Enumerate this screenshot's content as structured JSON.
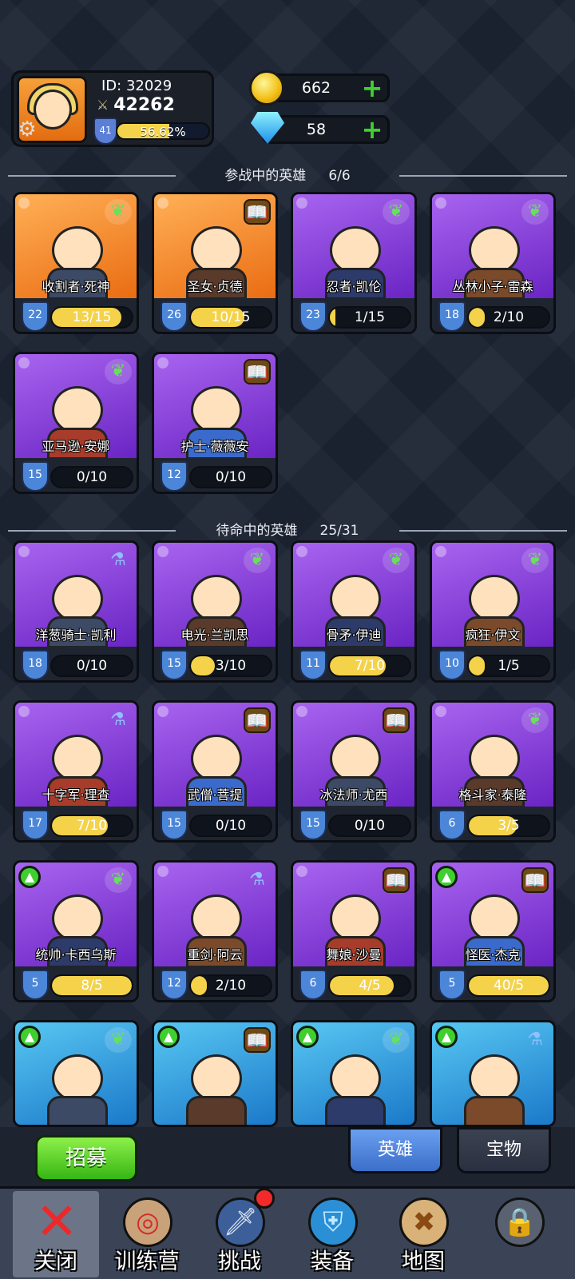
{
  "player": {
    "id_text": "ID: 32029",
    "power": "42262",
    "level": "41",
    "xp_percent_text": "56.62%",
    "xp_percent": 56.62
  },
  "currency": {
    "gold": "662",
    "gems": "58"
  },
  "sections": {
    "active": {
      "title": "参战中的英雄",
      "count": "6/6"
    },
    "standby": {
      "title": "待命中的英雄",
      "count": "25/31"
    }
  },
  "heroes": [
    {
      "name": "收割者·死神",
      "level": "22",
      "progress": "13/15",
      "fill": 0.87,
      "bg": "orange",
      "badge": "wing",
      "up": false
    },
    {
      "name": "圣女·贞德",
      "level": "26",
      "progress": "10/15",
      "fill": 0.67,
      "bg": "orange",
      "badge": "book",
      "up": false
    },
    {
      "name": "忍者·凯伦",
      "level": "23",
      "progress": "1/15",
      "fill": 0.07,
      "bg": "purple",
      "badge": "wing",
      "up": false
    },
    {
      "name": "丛林小子·雷森",
      "level": "18",
      "progress": "2/10",
      "fill": 0.2,
      "bg": "purple",
      "badge": "wing",
      "up": false
    },
    {
      "name": "亚马逊·安娜",
      "level": "15",
      "progress": "0/10",
      "fill": 0,
      "bg": "purple",
      "badge": "wing",
      "up": false
    },
    {
      "name": "护士·薇薇安",
      "level": "12",
      "progress": "0/10",
      "fill": 0,
      "bg": "purple",
      "badge": "book",
      "up": false
    },
    {
      "name": "洋葱骑士·凯利",
      "level": "18",
      "progress": "0/10",
      "fill": 0,
      "bg": "purple",
      "badge": "pot",
      "up": false
    },
    {
      "name": "电光·兰凯思",
      "level": "15",
      "progress": "3/10",
      "fill": 0.3,
      "bg": "purple",
      "badge": "wing",
      "up": false
    },
    {
      "name": "骨矛·伊迪",
      "level": "11",
      "progress": "7/10",
      "fill": 0.7,
      "bg": "purple",
      "badge": "wing",
      "up": false
    },
    {
      "name": "疯狂·伊文",
      "level": "10",
      "progress": "1/5",
      "fill": 0.2,
      "bg": "purple",
      "badge": "wing",
      "up": false
    },
    {
      "name": "十字军·理查",
      "level": "17",
      "progress": "7/10",
      "fill": 0.7,
      "bg": "purple",
      "badge": "pot",
      "up": false
    },
    {
      "name": "武僧·菩提",
      "level": "15",
      "progress": "0/10",
      "fill": 0,
      "bg": "purple",
      "badge": "book",
      "up": false
    },
    {
      "name": "冰法师·尤西",
      "level": "15",
      "progress": "0/10",
      "fill": 0,
      "bg": "purple",
      "badge": "book",
      "up": false
    },
    {
      "name": "格斗家·泰隆",
      "level": "6",
      "progress": "3/5",
      "fill": 0.6,
      "bg": "purple",
      "badge": "wing",
      "up": false
    },
    {
      "name": "统帅·卡西乌斯",
      "level": "5",
      "progress": "8/5",
      "fill": 1,
      "bg": "purple",
      "badge": "wing",
      "up": true
    },
    {
      "name": "重剑·阿云",
      "level": "12",
      "progress": "2/10",
      "fill": 0.2,
      "bg": "purple",
      "badge": "pot",
      "up": false
    },
    {
      "name": "舞娘·沙曼",
      "level": "6",
      "progress": "4/5",
      "fill": 0.8,
      "bg": "purple",
      "badge": "book",
      "up": false
    },
    {
      "name": "怪医·杰克",
      "level": "5",
      "progress": "40/5",
      "fill": 1,
      "bg": "purple",
      "badge": "book",
      "up": true
    },
    {
      "name": "",
      "level": "",
      "progress": "",
      "fill": 0,
      "bg": "blue",
      "badge": "wing",
      "up": true
    },
    {
      "name": "",
      "level": "",
      "progress": "",
      "fill": 0,
      "bg": "blue",
      "badge": "book",
      "up": true
    },
    {
      "name": "",
      "level": "",
      "progress": "",
      "fill": 0,
      "bg": "blue",
      "badge": "wing",
      "up": true
    },
    {
      "name": "",
      "level": "",
      "progress": "",
      "fill": 0,
      "bg": "blue",
      "badge": "pot",
      "up": true
    }
  ],
  "buttons": {
    "recruit": "招募"
  },
  "tabs": {
    "heroes": "英雄",
    "treasure": "宝物"
  },
  "nav": {
    "close": "关闭",
    "training": "训练营",
    "challenge": "挑战",
    "equipment": "装备",
    "map": "地图"
  },
  "icons": {
    "settings": "gear-icon",
    "sword": "swords-icon",
    "wing": "wing-icon",
    "book": "book-icon",
    "potion": "potion-icon",
    "upgrade": "arrow-up-icon",
    "lock": "lock-icon"
  },
  "colors": {
    "accent_green": "#3fd12f",
    "gold_bar": "#f4d24a",
    "active_tab": "#4f86dd",
    "card_purple": "#8a44dc",
    "card_orange": "#f28a2a"
  }
}
